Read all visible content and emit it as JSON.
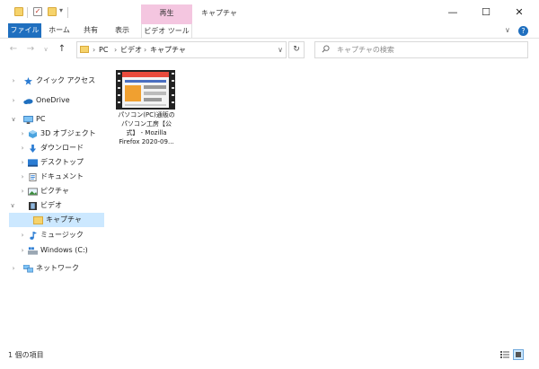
{
  "window": {
    "context_tab": "再生",
    "title": "キャプチャ",
    "min_symbol": "—",
    "max_symbol": "☐",
    "close_symbol": "✕"
  },
  "quick_access": {
    "dropdown_symbol": "▾",
    "check_symbol": "✓"
  },
  "ribbon": {
    "tabs": [
      "ファイル",
      "ホーム",
      "共有",
      "表示",
      "ビデオ ツール"
    ],
    "collapse_symbol": "∨",
    "help_symbol": "?"
  },
  "nav": {
    "back": "←",
    "forward": "→",
    "recent": "∨",
    "up": "↑",
    "path": [
      "PC",
      "ビデオ",
      "キャプチャ"
    ],
    "separator": "›",
    "dropdown": "∨",
    "refresh": "↻"
  },
  "search": {
    "placeholder": "キャプチャの検索"
  },
  "tree": [
    {
      "label": "クイック アクセス",
      "expander": "›",
      "icon": "star-icon"
    },
    {
      "label": "OneDrive",
      "expander": "›",
      "icon": "cloud-icon"
    },
    {
      "label": "PC",
      "expander": "∨",
      "icon": "computer-icon"
    },
    {
      "label": "3D オブジェクト",
      "expander": "›",
      "icon": "cube-icon"
    },
    {
      "label": "ダウンロード",
      "expander": "›",
      "icon": "download-icon"
    },
    {
      "label": "デスクトップ",
      "expander": "›",
      "icon": "desktop-icon"
    },
    {
      "label": "ドキュメント",
      "expander": "›",
      "icon": "document-icon"
    },
    {
      "label": "ピクチャ",
      "expander": "›",
      "icon": "picture-icon"
    },
    {
      "label": "ビデオ",
      "expander": "∨",
      "icon": "film-icon"
    },
    {
      "label": "キャプチャ",
      "expander": "",
      "icon": "folder-icon"
    },
    {
      "label": "ミュージック",
      "expander": "›",
      "icon": "music-icon"
    },
    {
      "label": "Windows (C:)",
      "expander": "›",
      "icon": "drive-icon"
    },
    {
      "label": "ネットワーク",
      "expander": "›",
      "icon": "network-icon"
    }
  ],
  "file": {
    "line1": "パソコン(PC)通販の",
    "line2": "パソコン工房【公",
    "line3": "式】 - Mozilla",
    "line4": "Firefox 2020-09..."
  },
  "status": {
    "text": "1 個の項目"
  },
  "colors": {
    "accent": "#1f6fbf",
    "context_tab": "#f4c6e0",
    "selection": "#cce8ff",
    "folder": "#f6d36b"
  }
}
